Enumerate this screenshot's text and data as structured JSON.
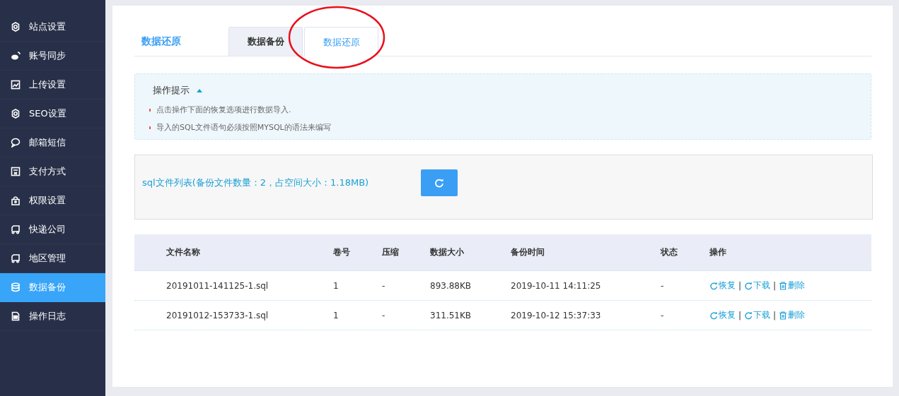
{
  "sidebar": {
    "items": [
      {
        "label": "站点设置",
        "selected": false
      },
      {
        "label": "账号同步",
        "selected": false
      },
      {
        "label": "上传设置",
        "selected": false
      },
      {
        "label": "SEO设置",
        "selected": false
      },
      {
        "label": "邮箱短信",
        "selected": false
      },
      {
        "label": "支付方式",
        "selected": false
      },
      {
        "label": "权限设置",
        "selected": false
      },
      {
        "label": "快递公司",
        "selected": false
      },
      {
        "label": "地区管理",
        "selected": false
      },
      {
        "label": "数据备份",
        "selected": true
      },
      {
        "label": "操作日志",
        "selected": false
      }
    ]
  },
  "page_title": "数据还原",
  "tabs": [
    {
      "label": "数据备份",
      "selected": false
    },
    {
      "label": "数据还原",
      "selected": true
    }
  ],
  "tips": {
    "title": "操作提示",
    "expanded": true,
    "items": [
      "点击操作下面的恢复选项进行数据导入.",
      "导入的SQL文件语句必须按照MYSQL的语法来编写"
    ]
  },
  "file_list": {
    "summary": "sql文件列表(备份文件数量：2，占空间大小：1.18MB)"
  },
  "table": {
    "columns": [
      "文件名称",
      "卷号",
      "压缩",
      "数据大小",
      "备份时间",
      "状态",
      "操作"
    ],
    "rows": [
      {
        "cells": [
          "20191011-141125-1.sql",
          "1",
          "-",
          "893.88KB",
          "2019-10-11 14:11:25",
          "-"
        ],
        "actions": [
          {
            "kind": "restore",
            "label": "恢复"
          },
          {
            "kind": "download",
            "label": "下载"
          },
          {
            "kind": "delete",
            "label": "删除"
          }
        ],
        "separator": "|"
      },
      {
        "cells": [
          "20191012-153733-1.sql",
          "1",
          "-",
          "311.51KB",
          "2019-10-12 15:37:33",
          "-"
        ],
        "actions": [
          {
            "kind": "restore",
            "label": "恢复"
          },
          {
            "kind": "download",
            "label": "下载"
          },
          {
            "kind": "delete",
            "label": "删除"
          }
        ],
        "separator": "|"
      }
    ]
  }
}
